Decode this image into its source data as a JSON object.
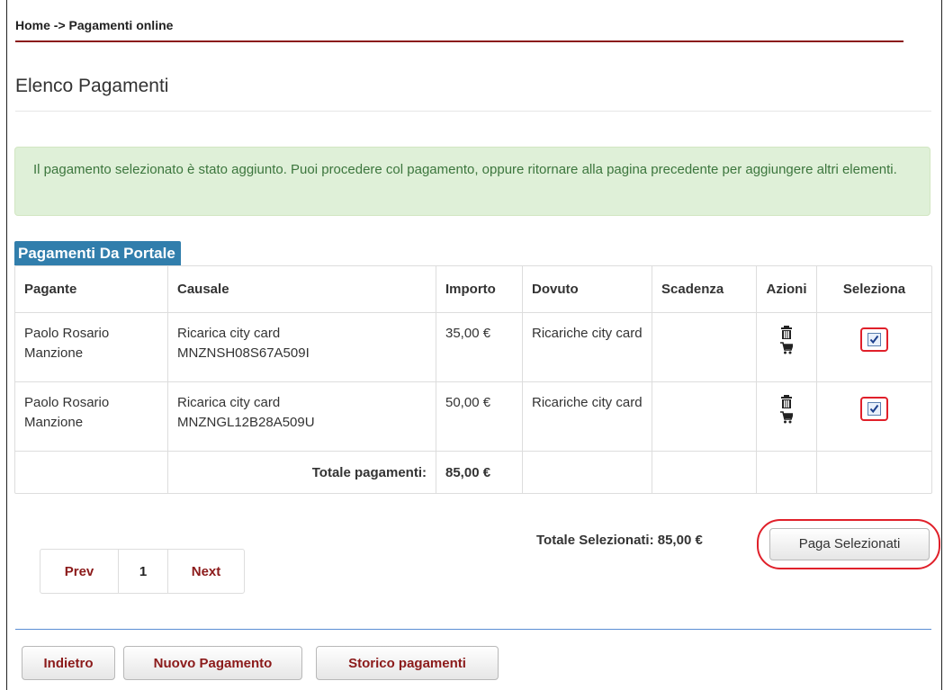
{
  "breadcrumb": "Home -> Pagamenti online",
  "page_title": "Elenco Pagamenti",
  "alert_message": "Il pagamento selezionato è stato aggiunto. Puoi procedere col pagamento, oppure ritornare alla pagina precedente per aggiungere altri elementi.",
  "panel_title": "Pagamenti Da Portale",
  "table": {
    "headers": {
      "pagante": "Pagante",
      "causale": "Causale",
      "importo": "Importo",
      "dovuto": "Dovuto",
      "scadenza": "Scadenza",
      "azioni": "Azioni",
      "seleziona": "Seleziona"
    },
    "rows": [
      {
        "pagante": "Paolo Rosario Manzione",
        "causale_line1": "Ricarica city card",
        "causale_line2": "MNZNSH08S67A509I",
        "importo": "35,00 €",
        "dovuto": "Ricariche city card",
        "scadenza": "",
        "selected": true
      },
      {
        "pagante": "Paolo Rosario Manzione",
        "causale_line1": "Ricarica city card",
        "causale_line2": "MNZNGL12B28A509U",
        "importo": "50,00 €",
        "dovuto": "Ricariche city card",
        "scadenza": "",
        "selected": true
      }
    ],
    "total_label": "Totale pagamenti:",
    "total_value": "85,00 €"
  },
  "selected_total": "Totale Selezionati: 85,00 €",
  "pay_button": "Paga Selezionati",
  "pagination": {
    "prev": "Prev",
    "page": "1",
    "next": "Next"
  },
  "footer_buttons": {
    "back": "Indietro",
    "new_payment": "Nuovo Pagamento",
    "history": "Storico pagamenti"
  },
  "colors": {
    "brand_red": "#8b1a1a",
    "panel_blue": "#317eac",
    "alert_green_bg": "#dff0d8",
    "alert_green_text": "#3c763d",
    "highlight_red": "#e0202a"
  },
  "icons": {
    "delete": "trash-icon",
    "cart": "cart-icon",
    "select": "checkbox"
  }
}
